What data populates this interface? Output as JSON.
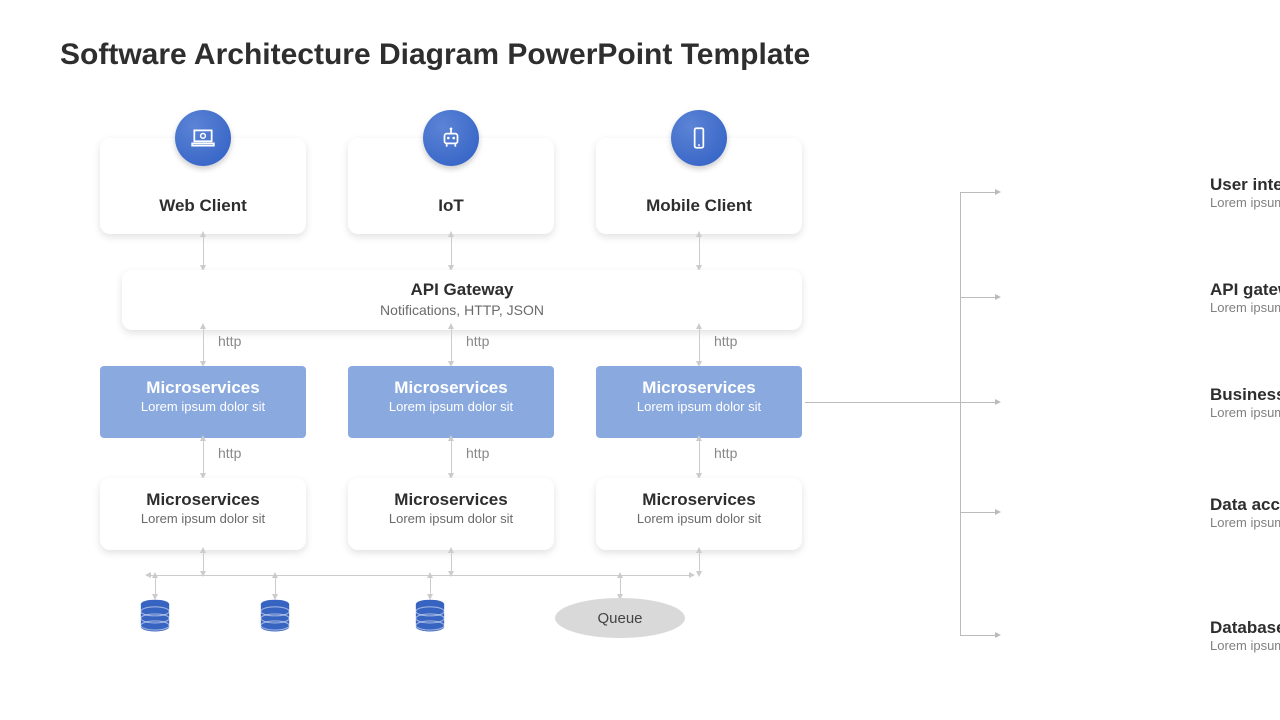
{
  "title": "Software Architecture Diagram PowerPoint Template",
  "clients": [
    {
      "label": "Web Client",
      "icon": "laptop"
    },
    {
      "label": "IoT",
      "icon": "robot"
    },
    {
      "label": "Mobile Client",
      "icon": "phone"
    }
  ],
  "api": {
    "title": "API Gateway",
    "subtitle": "Notifications, HTTP, JSON"
  },
  "http_label": "http",
  "microservices_blue": [
    {
      "title": "Microservices",
      "subtitle": "Lorem ipsum dolor sit"
    },
    {
      "title": "Microservices",
      "subtitle": "Lorem ipsum dolor sit"
    },
    {
      "title": "Microservices",
      "subtitle": "Lorem ipsum dolor sit"
    }
  ],
  "microservices_white": [
    {
      "title": "Microservices",
      "subtitle": "Lorem ipsum dolor sit"
    },
    {
      "title": "Microservices",
      "subtitle": "Lorem ipsum dolor sit"
    },
    {
      "title": "Microservices",
      "subtitle": "Lorem ipsum dolor sit"
    }
  ],
  "queue_label": "Queue",
  "layers": [
    {
      "title": "User interface layer",
      "subtitle": "Lorem ipsum dolor sit"
    },
    {
      "title": "API gateway layer",
      "subtitle": "Lorem ipsum dolor sit"
    },
    {
      "title": "Business logic layer",
      "subtitle": "Lorem ipsum dolor sit"
    },
    {
      "title": "Data access layer",
      "subtitle": "Lorem ipsum dolor sit"
    },
    {
      "title": "Database layer",
      "subtitle": "Lorem ipsum dolor sit"
    }
  ],
  "colors": {
    "accent": "#3763c1",
    "box_blue": "#8aa9de"
  }
}
